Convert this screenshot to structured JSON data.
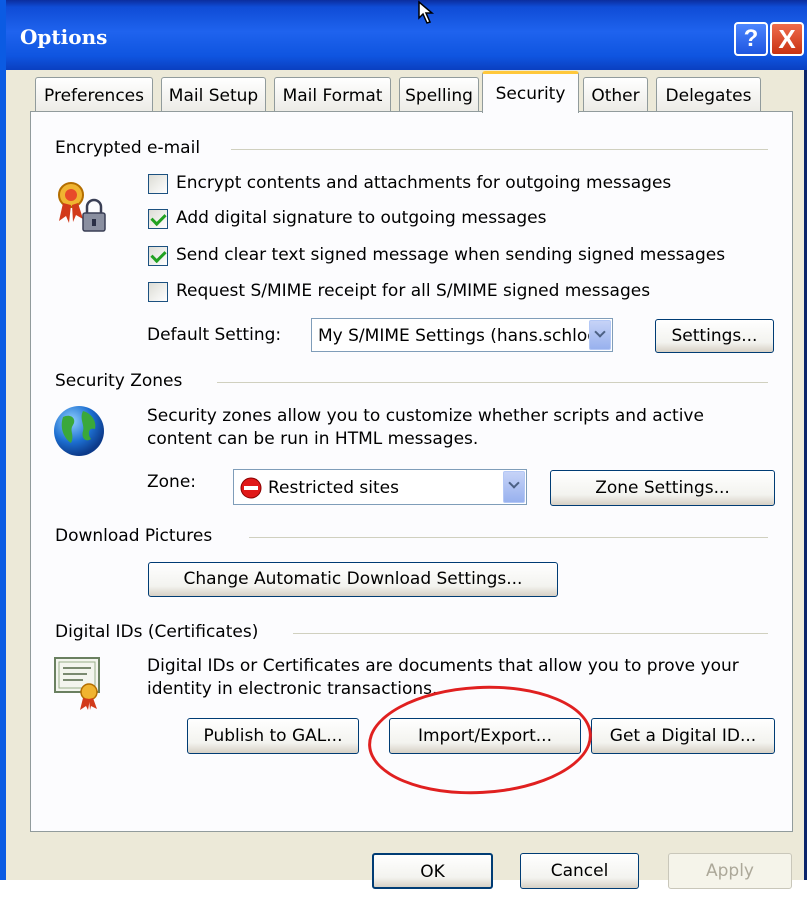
{
  "window": {
    "title": "Options",
    "help_glyph": "?",
    "close_glyph": "X"
  },
  "tabs": [
    {
      "label": "Preferences"
    },
    {
      "label": "Mail Setup"
    },
    {
      "label": "Mail Format"
    },
    {
      "label": "Spelling"
    },
    {
      "label": "Security",
      "active": true
    },
    {
      "label": "Other"
    },
    {
      "label": "Delegates"
    }
  ],
  "encrypted_email": {
    "heading": "Encrypted e-mail",
    "icon": "certificate-lock-icon",
    "options": [
      {
        "label": "Encrypt contents and attachments for outgoing messages",
        "checked": false
      },
      {
        "label": "Add digital signature to outgoing messages",
        "checked": true
      },
      {
        "label": "Send clear text signed message when sending signed messages",
        "checked": true
      },
      {
        "label": "Request S/MIME receipt for all S/MIME signed messages",
        "checked": false
      }
    ],
    "default_setting_label": "Default Setting:",
    "default_setting_value": "My S/MIME Settings (hans.schloe",
    "settings_button": "Settings..."
  },
  "security_zones": {
    "heading": "Security Zones",
    "icon": "globe-icon",
    "description_line1": "Security zones allow you to customize whether scripts and active",
    "description_line2": "content can be run in HTML messages.",
    "zone_label": "Zone:",
    "zone_value": "Restricted sites",
    "zone_icon": "restricted-icon",
    "zone_settings_button": "Zone Settings..."
  },
  "download_pictures": {
    "heading": "Download Pictures",
    "button": "Change Automatic Download Settings..."
  },
  "digital_ids": {
    "heading": "Digital IDs (Certificates)",
    "icon": "certificate-icon",
    "description_line1": "Digital IDs or Certificates are documents that allow you to prove your",
    "description_line2": "identity in electronic transactions.",
    "publish_button": "Publish to GAL...",
    "import_export_button": "Import/Export...",
    "get_id_button": "Get a Digital ID..."
  },
  "footer": {
    "ok": "OK",
    "cancel": "Cancel",
    "apply": "Apply"
  },
  "colors": {
    "titlebar": "#0f55e0",
    "dialog_bg": "#ece9d8",
    "annotation": "#e02020",
    "active_tab_accent": "#ffc83c"
  }
}
